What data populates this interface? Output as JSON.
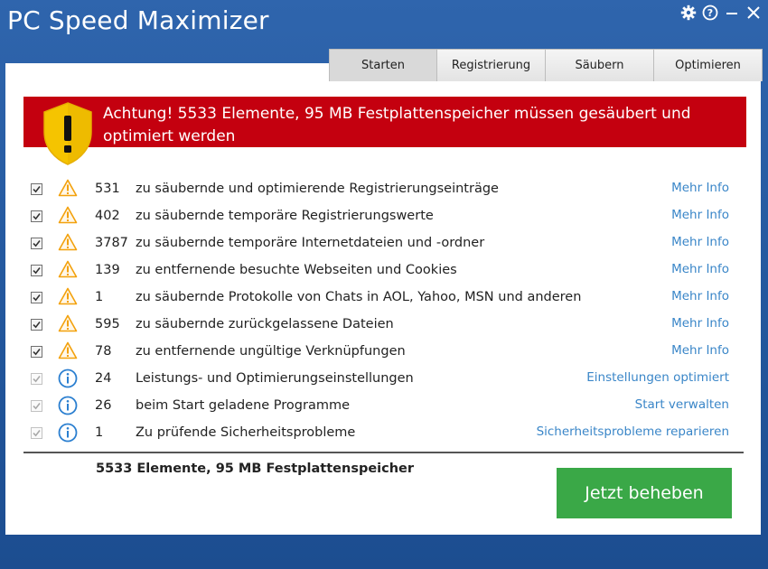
{
  "window": {
    "title": "PC Speed Maximizer",
    "controls": [
      {
        "name": "settings",
        "icon": "gear-icon"
      },
      {
        "name": "help",
        "icon": "help-icon"
      },
      {
        "name": "minimize",
        "icon": "minimize-icon"
      },
      {
        "name": "close",
        "icon": "close-icon"
      }
    ]
  },
  "tabs": [
    {
      "label": "Starten",
      "active": true
    },
    {
      "label": "Registrierung",
      "active": false
    },
    {
      "label": "Säubern",
      "active": false
    },
    {
      "label": "Optimieren",
      "active": false
    }
  ],
  "alert": {
    "text": "Achtung! 5533 Elemente, 95 MB Festplattenspeicher müssen gesäubert und optimiert werden",
    "icon": "warning-shield-icon",
    "color": "#c4000f"
  },
  "items": [
    {
      "checked": true,
      "icon": "warning-icon",
      "count": "531",
      "description": "zu säubernde und optimierende Registrierungseinträge",
      "link": "Mehr Info"
    },
    {
      "checked": true,
      "icon": "warning-icon",
      "count": "402",
      "description": "zu säubernde temporäre Registrierungswerte",
      "link": "Mehr Info"
    },
    {
      "checked": true,
      "icon": "warning-icon",
      "count": "3787",
      "description": "zu säubernde temporäre Internetdateien und -ordner",
      "link": "Mehr Info"
    },
    {
      "checked": true,
      "icon": "warning-icon",
      "count": "139",
      "description": "zu entfernende besuchte Webseiten und Cookies",
      "link": "Mehr Info"
    },
    {
      "checked": true,
      "icon": "warning-icon",
      "count": "1",
      "description": "zu säubernde Protokolle von Chats in AOL, Yahoo, MSN und anderen",
      "link": "Mehr Info"
    },
    {
      "checked": true,
      "icon": "warning-icon",
      "count": "595",
      "description": "zu säubernde zurückgelassene Dateien",
      "link": "Mehr Info"
    },
    {
      "checked": true,
      "icon": "warning-icon",
      "count": "78",
      "description": "zu entfernende ungültige Verknüpfungen",
      "link": "Mehr Info"
    },
    {
      "checked": true,
      "icon": "info-icon",
      "count": "24",
      "description": "Leistungs- und Optimierungseinstellungen",
      "link": "Einstellungen optimiert"
    },
    {
      "checked": true,
      "icon": "info-icon",
      "count": "26",
      "description": "beim Start geladene Programme",
      "link": "Start verwalten"
    },
    {
      "checked": true,
      "icon": "info-icon",
      "count": "1",
      "description": "Zu prüfende Sicherheitsprobleme",
      "link": "Sicherheitsprobleme reparieren"
    }
  ],
  "summary": {
    "total": "5533 Elemente, 95 MB Festplattenspeicher"
  },
  "fix_button": {
    "label": "Jetzt beheben",
    "color": "#3aa847"
  },
  "colors": {
    "background": "#255aa0",
    "link": "#3a86c8",
    "warning": "#f3a10c",
    "info": "#2b7fd0"
  }
}
